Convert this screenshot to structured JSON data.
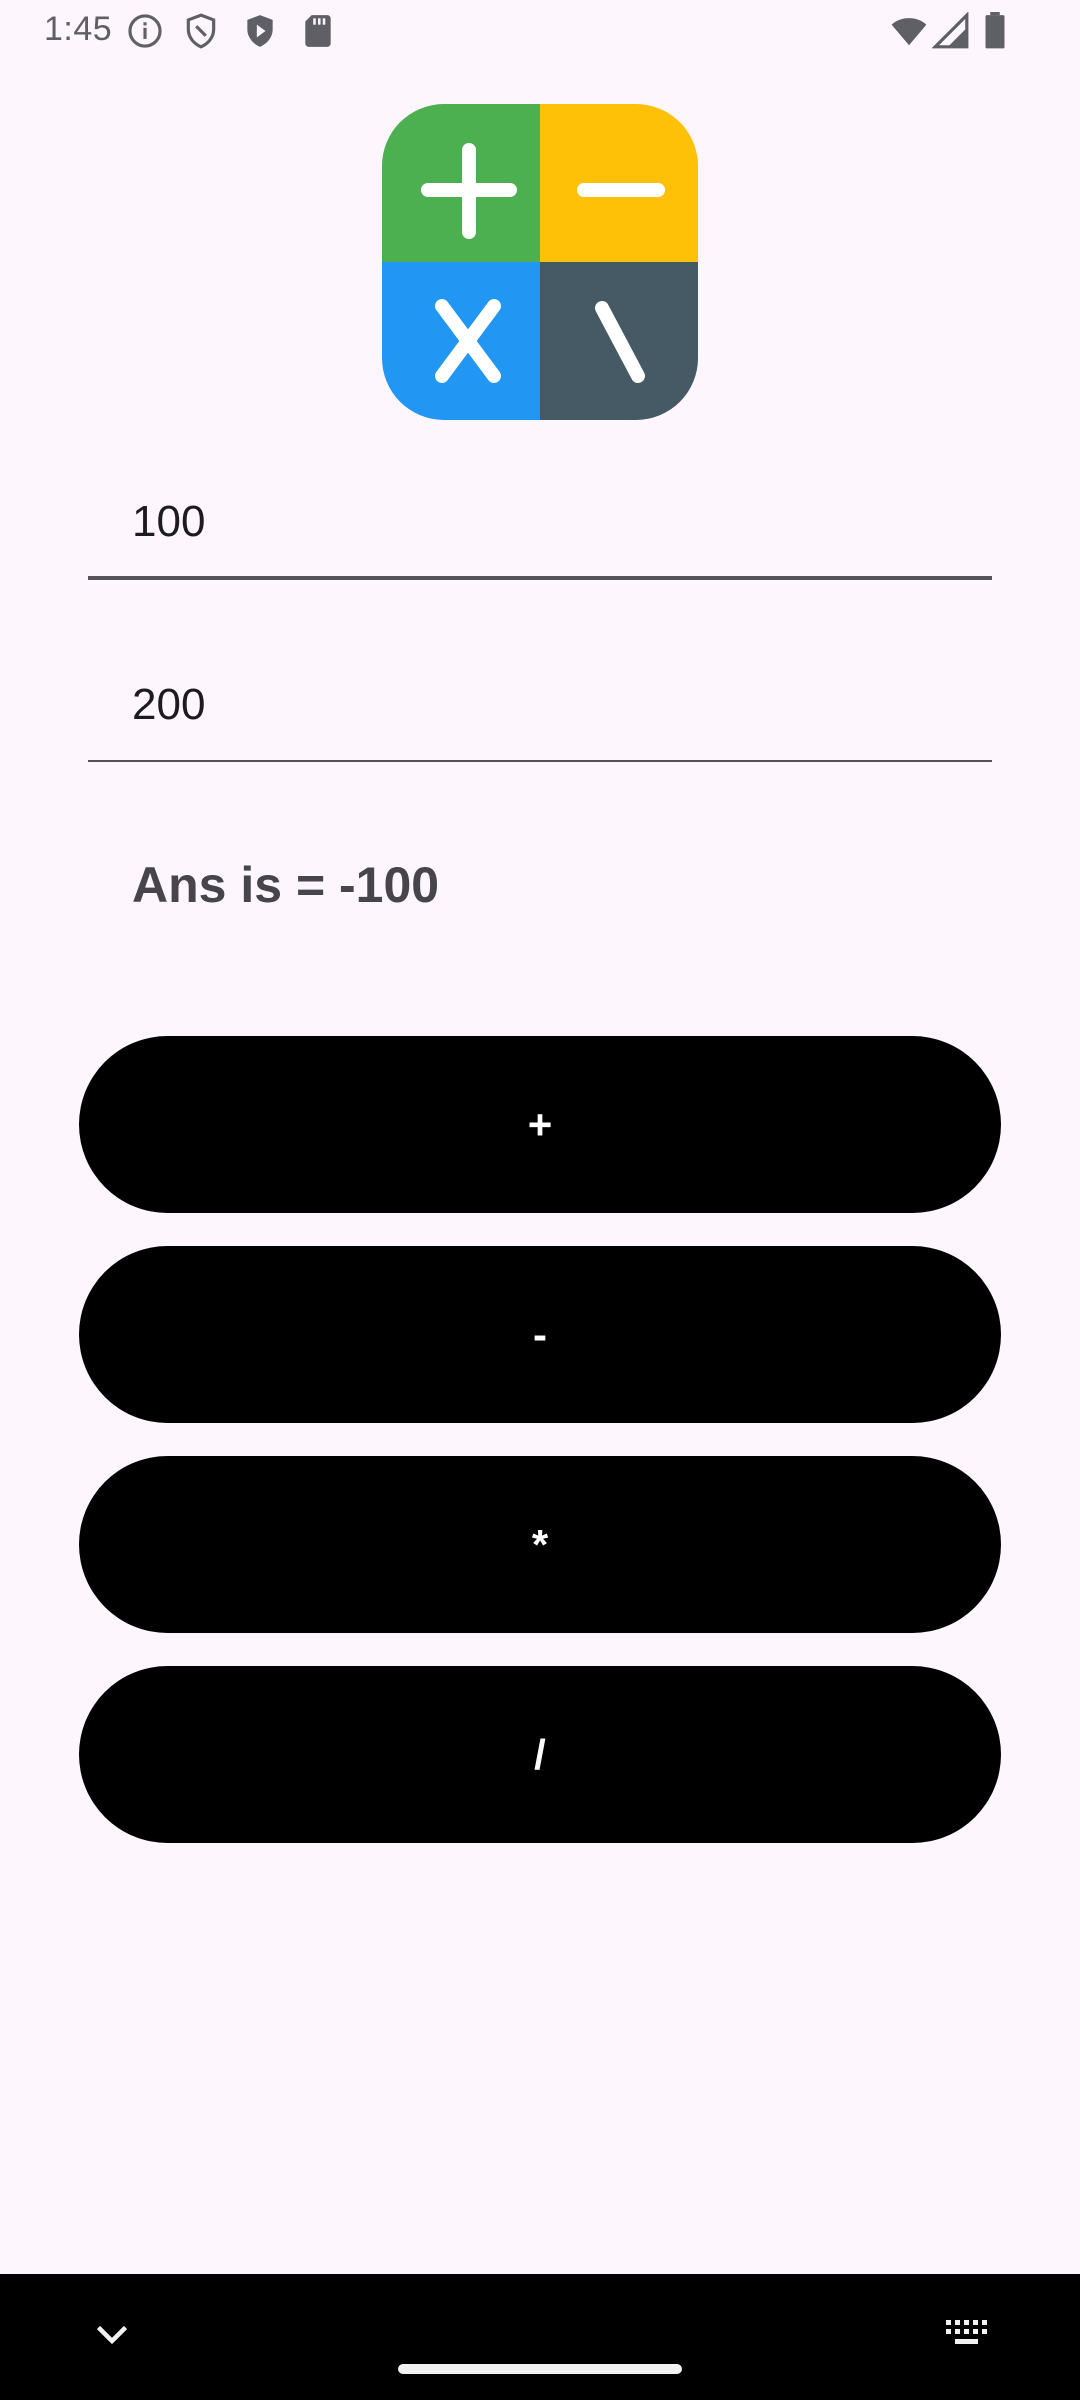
{
  "status_bar": {
    "time": "1:45",
    "icons": [
      "info-icon",
      "shield-outline-icon",
      "shield-play-icon",
      "play-store-icon",
      "sd-card-icon",
      "wifi-icon",
      "signal-icon",
      "battery-icon"
    ]
  },
  "logo": {
    "tiles": [
      {
        "color": "#4caf50",
        "symbol": "plus"
      },
      {
        "color": "#ffc107",
        "symbol": "minus"
      },
      {
        "color": "#2196f3",
        "symbol": "times"
      },
      {
        "color": "#455a64",
        "symbol": "backslash"
      }
    ]
  },
  "inputs": {
    "first_number": "100",
    "second_number": "200"
  },
  "answer_text": "Ans is = -100",
  "buttons": {
    "add": "+",
    "subtract": "-",
    "multiply": "*",
    "divide": "/"
  },
  "nav_bar": {
    "icons": [
      "chevron-down-icon",
      "home-handle",
      "keyboard-icon"
    ]
  },
  "colors": {
    "background": "#fdf6fc",
    "button": "#000000",
    "button_text": "#ffffff",
    "answer_text": "#46454b"
  }
}
